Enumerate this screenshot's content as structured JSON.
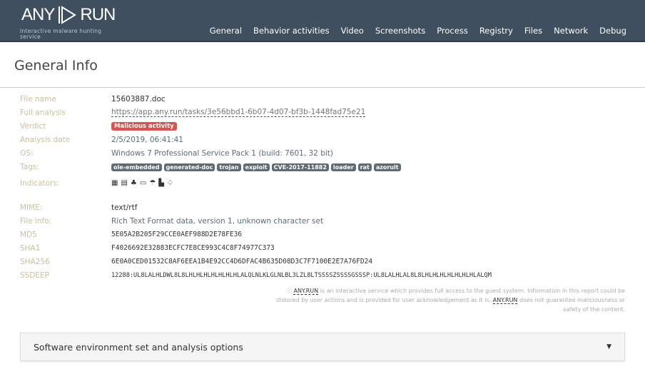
{
  "header": {
    "logo_left": "ANY",
    "logo_right": "RUN",
    "tagline": "Interactive malware hunting service",
    "nav": [
      "General",
      "Behavior activities",
      "Video",
      "Screenshots",
      "Process",
      "Registry",
      "Files",
      "Network",
      "Debug"
    ]
  },
  "title": "General Info",
  "fields": {
    "file_name": {
      "label": "File name",
      "value": "15603887.doc"
    },
    "full_analysis": {
      "label": "Full analysis",
      "value": "https://app.any.run/tasks/3e56bbd1-6b07-4d07-bf3b-1448fad75e21"
    },
    "verdict": {
      "label": "Verdict",
      "value": "Malicious activity"
    },
    "date": {
      "label": "Analysis date",
      "value": "2/5/2019, 06:41:41"
    },
    "os": {
      "label": "OS:",
      "value": "Windows 7 Professional Service Pack 1 (build: 7601, 32 bit)"
    },
    "tags": {
      "label": "Tags:",
      "values": [
        "ole-embedded",
        "generated-doc",
        "trojan",
        "exploit",
        "CVE-2017-11882",
        "loader",
        "rat",
        "azorult"
      ]
    },
    "indicators": {
      "label": "Indicators:",
      "icons": [
        "network-icon",
        "screen-icon",
        "spy-icon",
        "window-icon",
        "cloud-icon",
        "executable-icon",
        "hat-icon"
      ]
    },
    "mime": {
      "label": "MIME:",
      "value": "text/rtf"
    },
    "file_info": {
      "label": "File info:",
      "value": "Rich Text Format data, version 1, unknown character set"
    },
    "md5": {
      "label": "MD5",
      "value": "5E05A2B205F29CCE0AEF988D2E78FE36"
    },
    "sha1": {
      "label": "SHA1",
      "value": "F4026692E32883ECFC7E8CE993C4C8F74977C373"
    },
    "sha256": {
      "label": "SHA256",
      "value": "6E0A0CED01532C8AF6EEA1B4E92CC4D6DFAC4B635D08D3C7F7100E2E7A76FD24"
    },
    "ssdeep": {
      "label": "SSDEEP",
      "value": "12288:UL8LALHLDWL8L8LHLHLHLHLHLHLHLALQLNLKLGLNLBL3LZL8LTSSSSZSSSSGSSSP:UL8LALHLAL8L8LHLHLHLHLHLHLHLALQM"
    }
  },
  "notice": {
    "brand": "ANY.RUN",
    "text1": " is an interactive service which provides full access to the guest system. Information in this report could be distored by user actions and is provided for user acknowledgement as it is. ",
    "text2": " does not guarantee maliciousness or safety of the content."
  },
  "panel": {
    "label": "Software environment set and analysis options"
  }
}
